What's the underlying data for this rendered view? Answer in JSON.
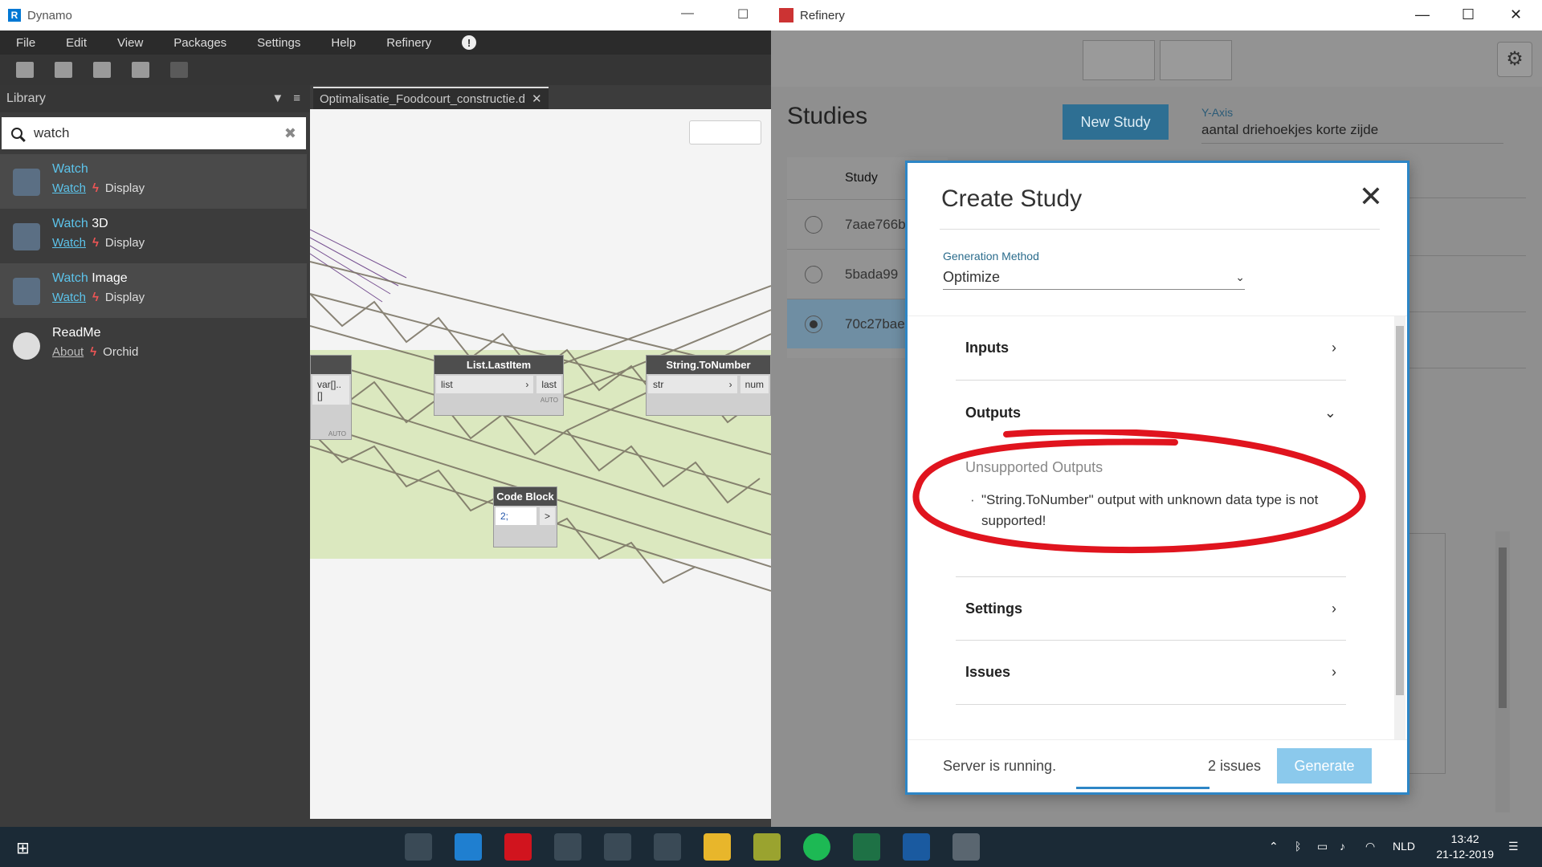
{
  "dynamo": {
    "title": "Dynamo",
    "logo_letter": "R",
    "menu": [
      "File",
      "Edit",
      "View",
      "Packages",
      "Settings",
      "Help",
      "Refinery"
    ],
    "library_title": "Library",
    "search_value": "watch",
    "library_items": [
      {
        "name_hl": "Watch",
        "name_rest": "",
        "category": "Watch",
        "group": "Display"
      },
      {
        "name_hl": "Watch",
        "name_rest": " 3D",
        "category": "Watch",
        "group": "Display"
      },
      {
        "name_hl": "Watch",
        "name_rest": " Image",
        "category": "Watch",
        "group": "Display"
      },
      {
        "name_hl": "",
        "name_rest": "ReadMe",
        "category": "About",
        "group": "Orchid"
      }
    ],
    "tab_title": "Optimalisatie_Foodcourt_constructie.d",
    "nodes": {
      "n1": {
        "in": "var[]..[]",
        "auto": "AUTO"
      },
      "list_last": {
        "title": "List.LastItem",
        "in": "list",
        "out": "last",
        "auto": "AUTO"
      },
      "string_num": {
        "title": "String.ToNumber",
        "in": "str",
        "out": "num"
      },
      "code_block": {
        "title": "Code Block",
        "code": "2;",
        "out": ">"
      }
    }
  },
  "refinery": {
    "title": "Refinery",
    "studies_title": "Studies",
    "new_study_label": "New Study",
    "y_axis_label": "Y-Axis",
    "y_axis_value": "aantal driehoekjes korte zijde",
    "table_header": "Study",
    "studies": [
      "7aae766b",
      "5bada99",
      "70c27bae"
    ],
    "modal": {
      "title": "Create Study",
      "generation_label": "Generation Method",
      "generation_value": "Optimize",
      "sections": {
        "inputs": "Inputs",
        "outputs": "Outputs",
        "settings": "Settings",
        "issues": "Issues"
      },
      "unsupported_title": "Unsupported Outputs",
      "unsupported_text": "\"String.ToNumber\" output with unknown data type is not supported!",
      "status": "Server is running.",
      "issues_count": "2 issues",
      "generate_label": "Generate"
    }
  },
  "taskbar": {
    "language": "NLD",
    "time": "13:42",
    "date": "21-12-2019"
  },
  "colors": {
    "accent": "#2d86c6",
    "highlight_text": "#5cc3ea",
    "annotation": "#e0141e"
  }
}
